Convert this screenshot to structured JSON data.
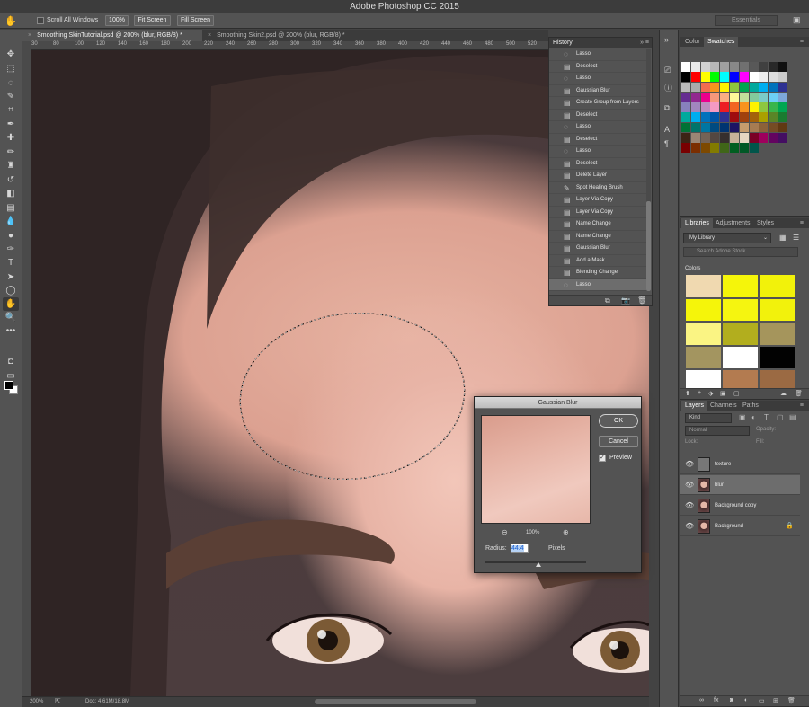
{
  "app": {
    "title": "Adobe Photoshop CC 2015"
  },
  "options_bar": {
    "scroll_all_label": "Scroll All Windows",
    "zoom_btn": "100%",
    "fit_btn": "Fit Screen",
    "fill_btn": "Fill Screen",
    "workspace_placeholder": "Essentials"
  },
  "doc_tabs": [
    {
      "label": "Smoothing SkinTutorial.psd @ 200% (blur, RGB/8) *",
      "active": true
    },
    {
      "label": "Smoothing Skin2.psd @ 200% (blur, RGB/8) *",
      "active": false
    }
  ],
  "ruler_ticks": [
    "30",
    "80",
    "100",
    "120",
    "140",
    "160",
    "180",
    "200",
    "220",
    "240",
    "260",
    "280",
    "300",
    "320",
    "340",
    "360",
    "380",
    "400",
    "420",
    "440",
    "460",
    "480",
    "500",
    "520"
  ],
  "status_bar": {
    "zoom": "200%",
    "doc": "Doc: 4.61M/18.8M"
  },
  "history": {
    "title": "History",
    "items": [
      {
        "label": "Lasso",
        "icon": "lasso-icon"
      },
      {
        "label": "Deselect",
        "icon": "doc-icon"
      },
      {
        "label": "Lasso",
        "icon": "lasso-icon"
      },
      {
        "label": "Gaussian Blur",
        "icon": "doc-icon"
      },
      {
        "label": "Create Group from Layers",
        "icon": "doc-icon"
      },
      {
        "label": "Deselect",
        "icon": "doc-icon"
      },
      {
        "label": "Lasso",
        "icon": "lasso-icon"
      },
      {
        "label": "Deselect",
        "icon": "doc-icon"
      },
      {
        "label": "Lasso",
        "icon": "lasso-icon"
      },
      {
        "label": "Deselect",
        "icon": "doc-icon"
      },
      {
        "label": "Delete Layer",
        "icon": "doc-icon"
      },
      {
        "label": "Spot Healing Brush",
        "icon": "brush-icon"
      },
      {
        "label": "Layer Via Copy",
        "icon": "doc-icon"
      },
      {
        "label": "Layer Via Copy",
        "icon": "doc-icon"
      },
      {
        "label": "Name Change",
        "icon": "doc-icon"
      },
      {
        "label": "Name Change",
        "icon": "doc-icon"
      },
      {
        "label": "Gaussian Blur",
        "icon": "doc-icon"
      },
      {
        "label": "Add a Mask",
        "icon": "doc-icon"
      },
      {
        "label": "Blending Change",
        "icon": "doc-icon"
      },
      {
        "label": "Lasso",
        "icon": "lasso-icon",
        "selected": true
      }
    ]
  },
  "color_panel": {
    "tab_color": "Color",
    "tab_swatches": "Swatches"
  },
  "swatch_colors": [
    "#ffffff",
    "#e8e8e8",
    "#d0d0d0",
    "#b8b8b8",
    "#a0a0a0",
    "#888888",
    "#707070",
    "#585858",
    "#404040",
    "#282828",
    "#101010",
    "#000000",
    "#ff0000",
    "#ffff00",
    "#00ff00",
    "#00ffff",
    "#0000ff",
    "#ff00ff",
    "#ffffff",
    "#eeeeee",
    "#dddddd",
    "#cccccc",
    "#bbbbbb",
    "#aaaaaa",
    "#f26c4f",
    "#f7941d",
    "#fff200",
    "#8dc73f",
    "#00a651",
    "#00a99d",
    "#00aeef",
    "#0072bc",
    "#2e3192",
    "#662d91",
    "#92278f",
    "#ec008c",
    "#f7977a",
    "#fbad82",
    "#fff799",
    "#c4df9b",
    "#82ca9c",
    "#7accc8",
    "#6dcff6",
    "#7da7d9",
    "#8781bd",
    "#a186be",
    "#bd8cbf",
    "#f49ac2",
    "#ed1c24",
    "#f26522",
    "#f7941d",
    "#fff200",
    "#8dc73f",
    "#39b54a",
    "#00a651",
    "#00a99d",
    "#00aeef",
    "#0072bc",
    "#0054a6",
    "#2e3192",
    "#9e0b0f",
    "#a0410d",
    "#a3620a",
    "#aba000",
    "#598527",
    "#1a7b30",
    "#007236",
    "#00746b",
    "#0076a3",
    "#004a80",
    "#003471",
    "#1b1464",
    "#c69c6d",
    "#a67c52",
    "#8c6239",
    "#754c24",
    "#603913",
    "#3c2415",
    "#998675",
    "#736357",
    "#534741",
    "#362f2d",
    "#c7b299",
    "#e6d7c3",
    "#7a0026",
    "#9e005d",
    "#630460",
    "#440e62",
    "#790000",
    "#7b2e00",
    "#7d4900",
    "#827b00",
    "#406618",
    "#005e20",
    "#005826",
    "#00554a"
  ],
  "libraries_panel": {
    "tab_libraries": "Libraries",
    "tab_adjustments": "Adjustments",
    "tab_styles": "Styles",
    "library_name": "My Library",
    "search_placeholder": "Search Adobe Stock",
    "colors_label": "Colors",
    "colors": [
      "#f0d9b0",
      "#f5f50a",
      "#f2f20a",
      "#f5f50a",
      "#f5f510",
      "#f2f20c",
      "#faf483",
      "#b2ae1e",
      "#a5955c",
      "#a39560",
      "#ffffff",
      "#020202",
      "#ffffff",
      "#b37b50",
      "#9b6a43"
    ]
  },
  "layers_panel": {
    "tab_layers": "Layers",
    "tab_channels": "Channels",
    "tab_paths": "Paths",
    "kind_label": "Kind",
    "mode_label": "Normal",
    "opacity_label": "Opacity:",
    "lock_label": "Lock:",
    "fill_label": "Fill:",
    "layers": [
      {
        "name": "texture",
        "thumb": "gray",
        "selected": false,
        "locked": false
      },
      {
        "name": "blur",
        "thumb": "face",
        "selected": true,
        "locked": false
      },
      {
        "name": "Background copy",
        "thumb": "face",
        "selected": false,
        "locked": false
      },
      {
        "name": "Background",
        "thumb": "face",
        "selected": false,
        "locked": true
      }
    ]
  },
  "gaussian_dialog": {
    "title": "Gaussian Blur",
    "ok_label": "OK",
    "cancel_label": "Cancel",
    "preview_label": "Preview",
    "preview_checked": true,
    "zoom_text": "100%",
    "radius_label": "Radius:",
    "radius_value": "44.4",
    "radius_unit": "Pixels"
  }
}
